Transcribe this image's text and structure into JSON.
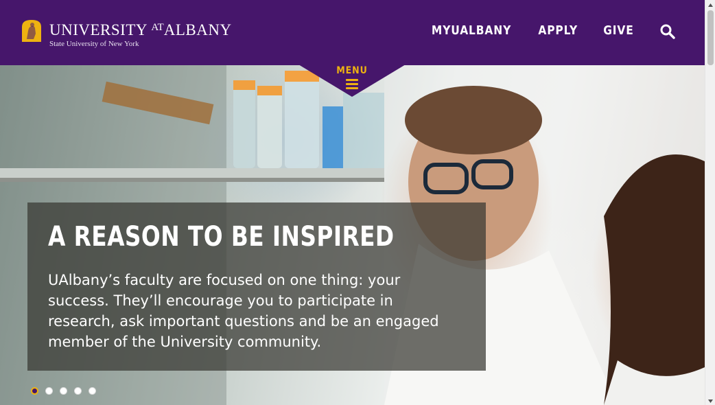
{
  "header": {
    "logo": {
      "main_part1": "UNIVERSITY",
      "main_at": "AT",
      "main_part2": "ALBANY",
      "subtitle": "State University of New York"
    },
    "nav": [
      {
        "label": "MYUALBANY"
      },
      {
        "label": "APPLY"
      },
      {
        "label": "GIVE"
      }
    ],
    "search_icon": "search-icon"
  },
  "menu": {
    "label": "MENU",
    "icon": "hamburger-icon"
  },
  "hero": {
    "title": "A REASON TO BE INSPIRED",
    "body": "UAlbany’s faculty are focused on one thing: your success. They’ll encourage you to participate in research, ask important questions and be an engaged member of the University community.",
    "slides_total": 5,
    "active_slide": 1
  },
  "colors": {
    "brand_purple": "#46166b",
    "brand_gold": "#eeb211"
  }
}
